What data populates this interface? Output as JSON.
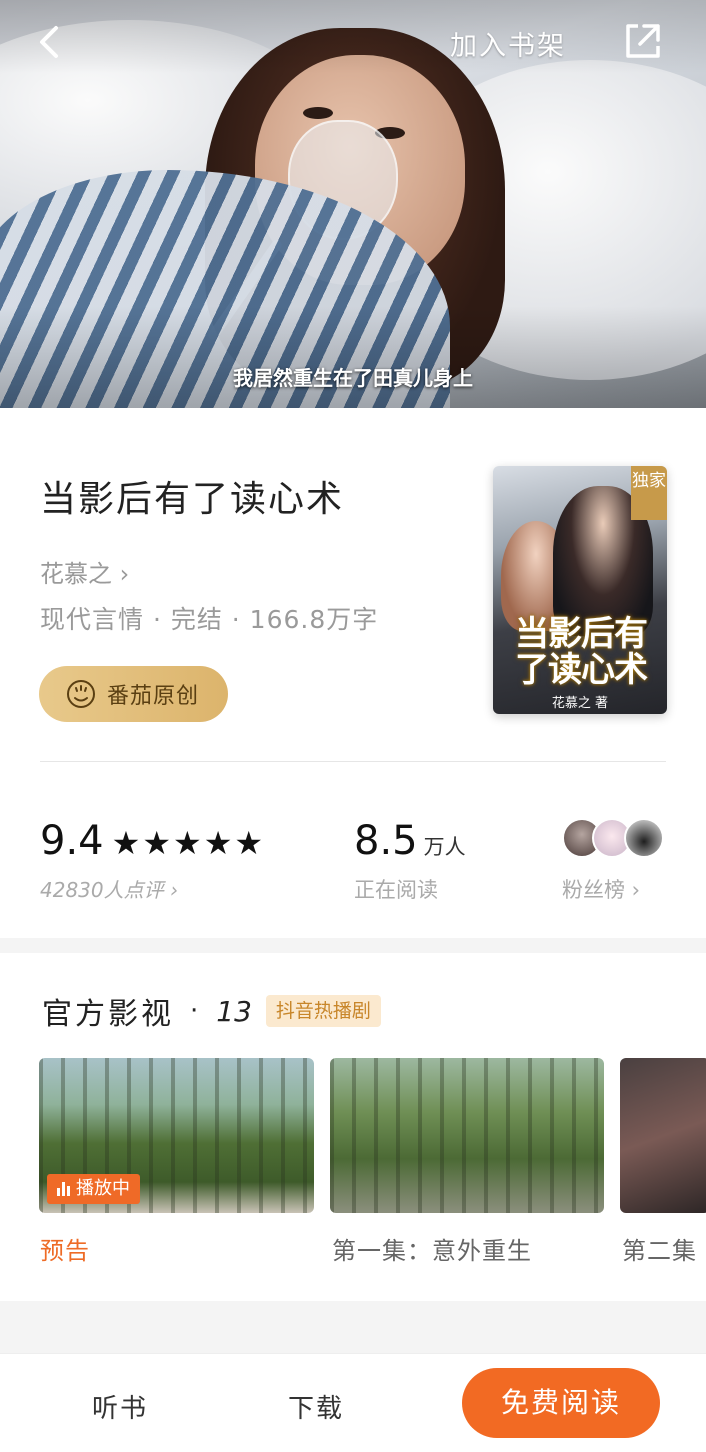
{
  "header": {
    "add_to_shelf": "加入书架",
    "subtitle": "我居然重生在了田真儿身上"
  },
  "book": {
    "title": "当影后有了读心术",
    "author": "花慕之",
    "author_chevron": "›",
    "meta": "现代言情 · 完结 · 166.8万字",
    "origin_badge": "番茄原创",
    "cover": {
      "exclusive": "独家",
      "cover_title_line1": "当影后有",
      "cover_title_line2": "了读心术",
      "cover_author": "花慕之 著"
    }
  },
  "stats": {
    "score": "9.4",
    "stars": "★★★★★",
    "rating_count": "42830人点评 ›",
    "readers_value": "8.5",
    "readers_unit": "万人",
    "readers_label": "正在阅读",
    "fans_label": "粉丝榜 ›"
  },
  "videos": {
    "section_title": "官方影视",
    "dot": "·",
    "count": "13",
    "hot_tag": "抖音热播剧",
    "playing_label": "播放中",
    "items": [
      {
        "caption": "预告"
      },
      {
        "caption": "第一集：意外重生"
      },
      {
        "caption": "第二集"
      }
    ]
  },
  "bottom_bar": {
    "listen": "听书",
    "download": "下载",
    "read_free": "免费阅读"
  },
  "colors": {
    "accent": "#f26a23",
    "gold_badge": "#e3c07c",
    "hot_tag_bg": "#fbe9cf"
  },
  "icons": {
    "back": "back-arrow-icon",
    "share": "share-icon",
    "origin": "tomato-icon"
  }
}
